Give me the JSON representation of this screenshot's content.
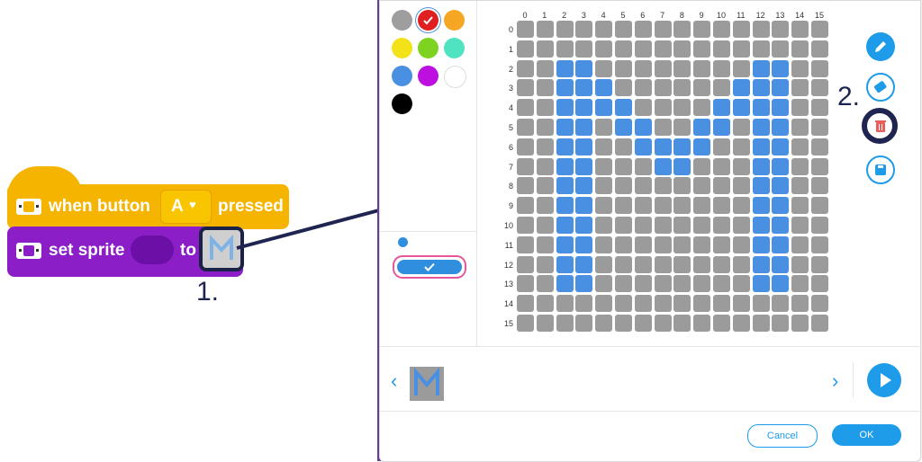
{
  "blocks": {
    "hat_label_prefix": "when button",
    "hat_dropdown_value": "A",
    "hat_label_suffix": "pressed",
    "set_label_prefix": "set sprite",
    "set_label_suffix": "to",
    "hat_color": "#f5b400",
    "set_color": "#8c1ec7"
  },
  "annotations": {
    "step1": "1.",
    "step2": "2."
  },
  "editor": {
    "palette": [
      "#9e9e9e",
      "#4a90e2-selected-red",
      "#f5a623",
      "#f8e71c",
      "#7ed321",
      "#50e3c2",
      "#4a90e2",
      "#bd10e0",
      "#ffffff",
      "#000000"
    ],
    "palette_colors": [
      "#9e9e9e",
      "#e02020",
      "#f5a623",
      "#f4e219",
      "#7ed321",
      "#50e3c2",
      "#4a90e2",
      "#bd10e0",
      "#ffffff",
      "#000000"
    ],
    "selected_color": "#e02020",
    "brush_color": "#2f8fde",
    "column_labels": [
      "0",
      "1",
      "2",
      "3",
      "4",
      "5",
      "6",
      "7",
      "8",
      "9",
      "10",
      "11",
      "12",
      "13",
      "14",
      "15"
    ],
    "row_labels": [
      "0",
      "1",
      "2",
      "3",
      "4",
      "5",
      "6",
      "7",
      "8",
      "9",
      "10",
      "11",
      "12",
      "13",
      "14",
      "15"
    ],
    "grid_empty_color": "#9b9b9b",
    "grid_fill_color": "#4a90e2",
    "filled_pixels": [
      [
        2,
        2
      ],
      [
        3,
        2
      ],
      [
        12,
        2
      ],
      [
        13,
        2
      ],
      [
        2,
        3
      ],
      [
        3,
        3
      ],
      [
        4,
        3
      ],
      [
        11,
        3
      ],
      [
        12,
        3
      ],
      [
        13,
        3
      ],
      [
        2,
        4
      ],
      [
        3,
        4
      ],
      [
        4,
        4
      ],
      [
        5,
        4
      ],
      [
        10,
        4
      ],
      [
        11,
        4
      ],
      [
        12,
        4
      ],
      [
        13,
        4
      ],
      [
        2,
        5
      ],
      [
        3,
        5
      ],
      [
        5,
        5
      ],
      [
        6,
        5
      ],
      [
        9,
        5
      ],
      [
        10,
        5
      ],
      [
        12,
        5
      ],
      [
        13,
        5
      ],
      [
        2,
        6
      ],
      [
        3,
        6
      ],
      [
        6,
        6
      ],
      [
        7,
        6
      ],
      [
        8,
        6
      ],
      [
        9,
        6
      ],
      [
        12,
        6
      ],
      [
        13,
        6
      ],
      [
        2,
        7
      ],
      [
        3,
        7
      ],
      [
        7,
        7
      ],
      [
        8,
        7
      ],
      [
        12,
        7
      ],
      [
        13,
        7
      ],
      [
        2,
        8
      ],
      [
        3,
        8
      ],
      [
        12,
        8
      ],
      [
        13,
        8
      ],
      [
        2,
        9
      ],
      [
        3,
        9
      ],
      [
        12,
        9
      ],
      [
        13,
        9
      ],
      [
        2,
        10
      ],
      [
        3,
        10
      ],
      [
        12,
        10
      ],
      [
        13,
        10
      ],
      [
        2,
        11
      ],
      [
        3,
        11
      ],
      [
        12,
        11
      ],
      [
        13,
        11
      ],
      [
        2,
        12
      ],
      [
        3,
        12
      ],
      [
        12,
        12
      ],
      [
        13,
        12
      ],
      [
        2,
        13
      ],
      [
        3,
        13
      ],
      [
        12,
        13
      ],
      [
        13,
        13
      ]
    ],
    "tools": [
      "pencil-icon",
      "eraser-icon",
      "trash-icon",
      "save-icon"
    ],
    "nav_prev": "‹",
    "nav_next": "›",
    "cancel_label": "Cancel",
    "ok_label": "OK",
    "accent_color": "#1e9be9"
  }
}
